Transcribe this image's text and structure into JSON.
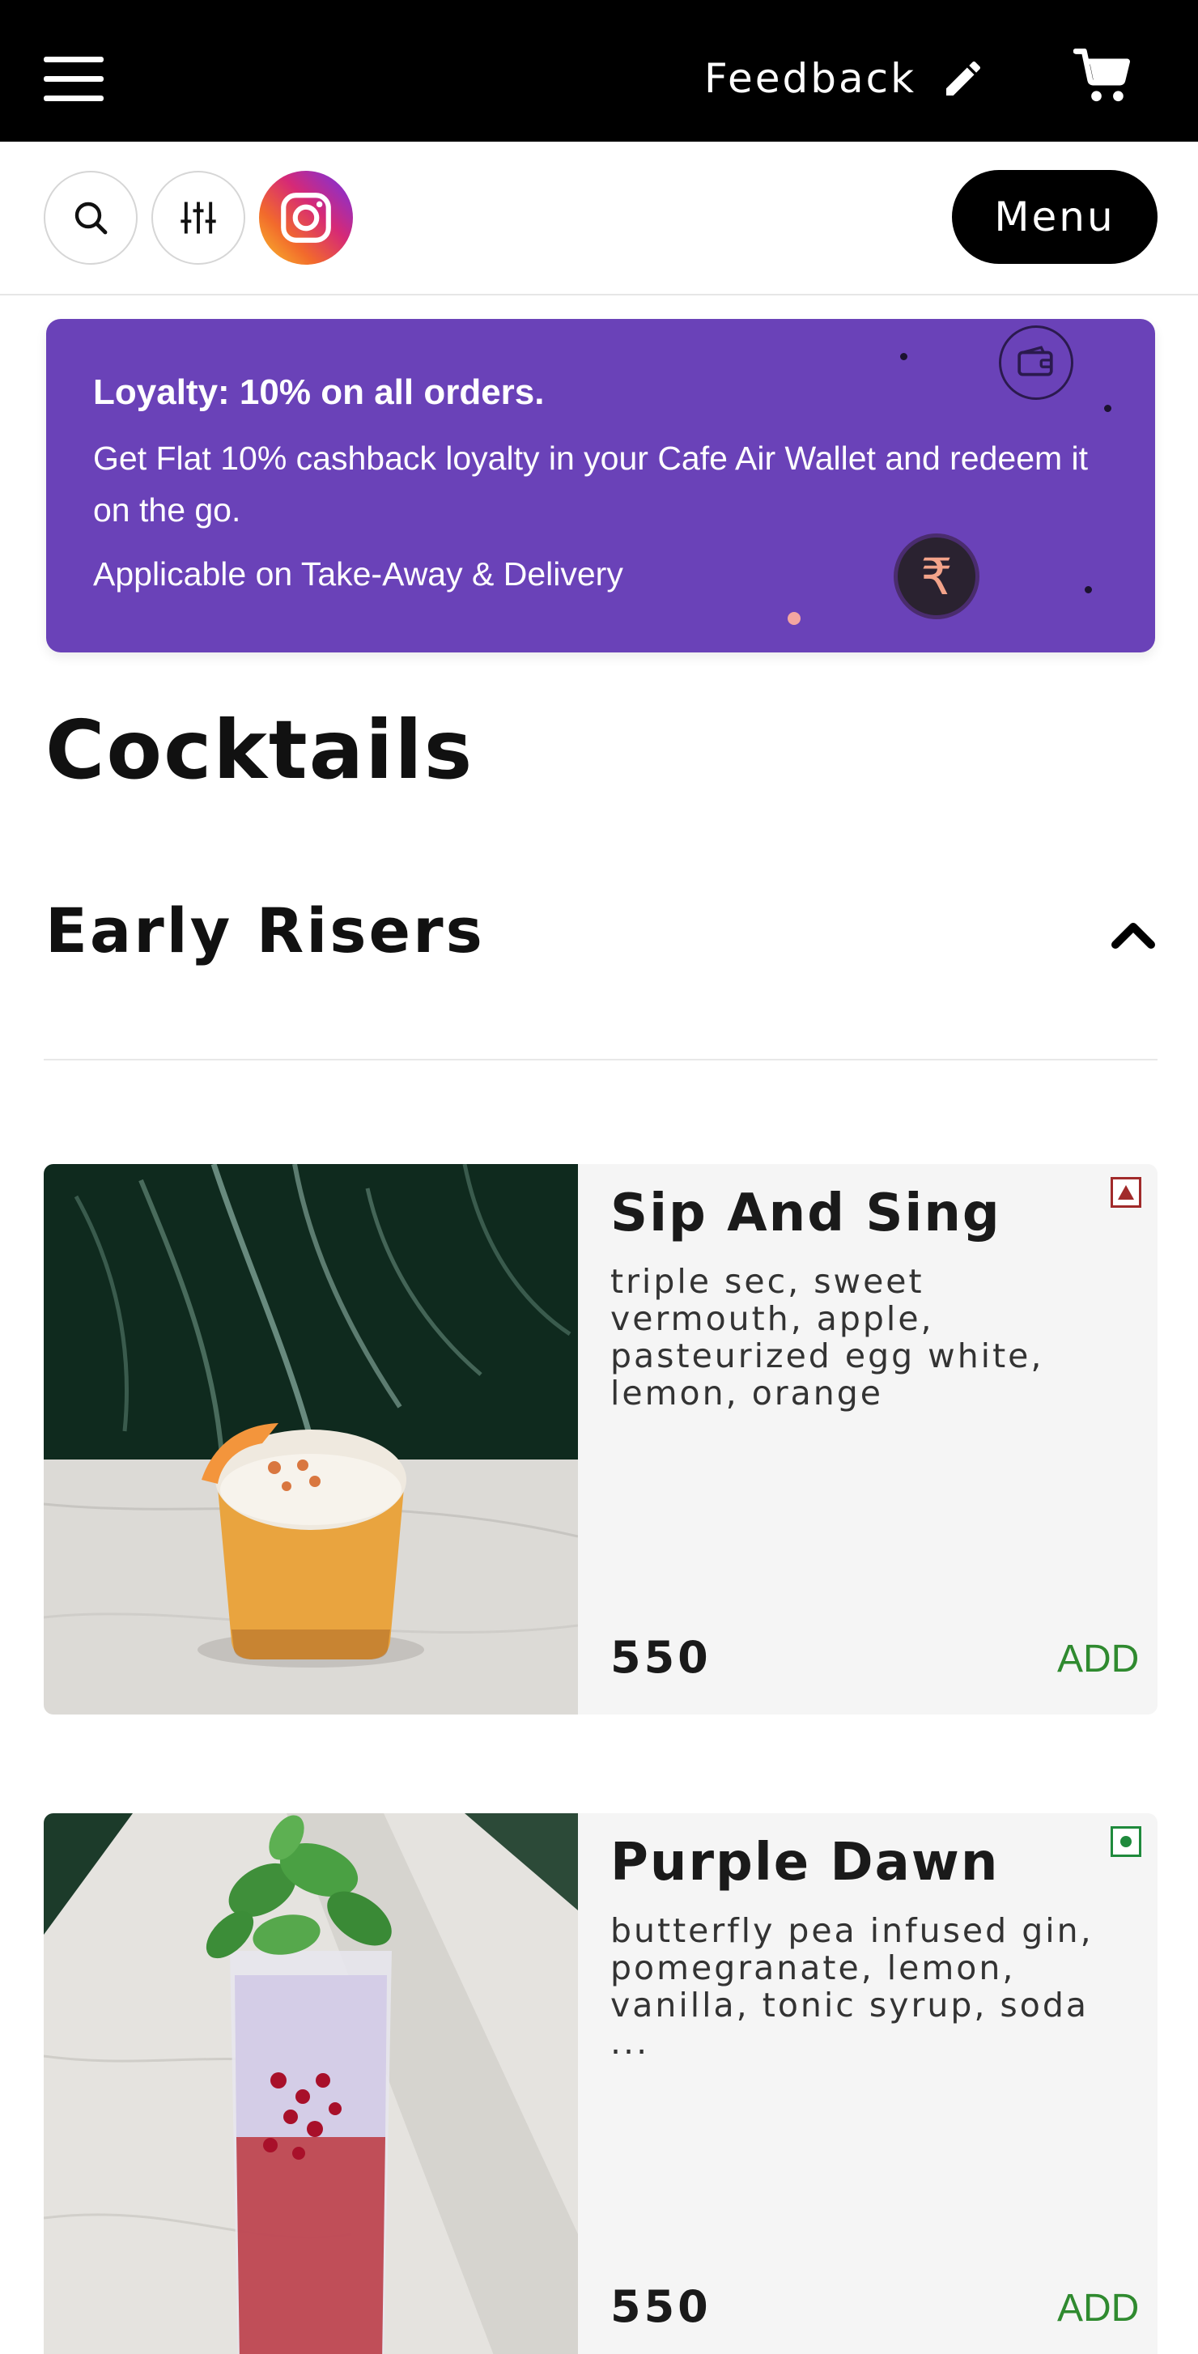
{
  "header": {
    "feedback_label": "Feedback",
    "icons": [
      "menu-icon",
      "pencil-icon",
      "cart-icon"
    ]
  },
  "toolbar": {
    "icons": [
      "search-icon",
      "filter-icon",
      "instagram-icon"
    ],
    "menu_label": "Menu"
  },
  "loyalty": {
    "title": "Loyalty: 10% on all orders.",
    "description": "Get Flat 10% cashback loyalty in your Cafe Air Wallet and redeem it on the go.",
    "note": "Applicable on Take-Away & Delivery",
    "rupee_symbol": "₹",
    "background_color": "#6a42b8"
  },
  "section": {
    "title": "Cocktails",
    "category": "Early Risers"
  },
  "items": [
    {
      "name": "Sip And Sing",
      "description": "triple sec, sweet vermouth, apple, pasteurized egg white, lemon, orange",
      "price": "550",
      "add_label": "ADD",
      "diet_mark": "non-veg",
      "diet_color": "#a12a2a"
    },
    {
      "name": "Purple Dawn",
      "description": "butterfly pea infused gin, pomegranate, lemon, vanilla, tonic syrup, soda ...",
      "price": "550",
      "add_label": "ADD",
      "diet_mark": "veg",
      "diet_color": "#1f8a3c"
    }
  ],
  "colors": {
    "topbar": "#000000",
    "add_button": "#2f8a2f",
    "card_background": "#f5f5f5"
  }
}
